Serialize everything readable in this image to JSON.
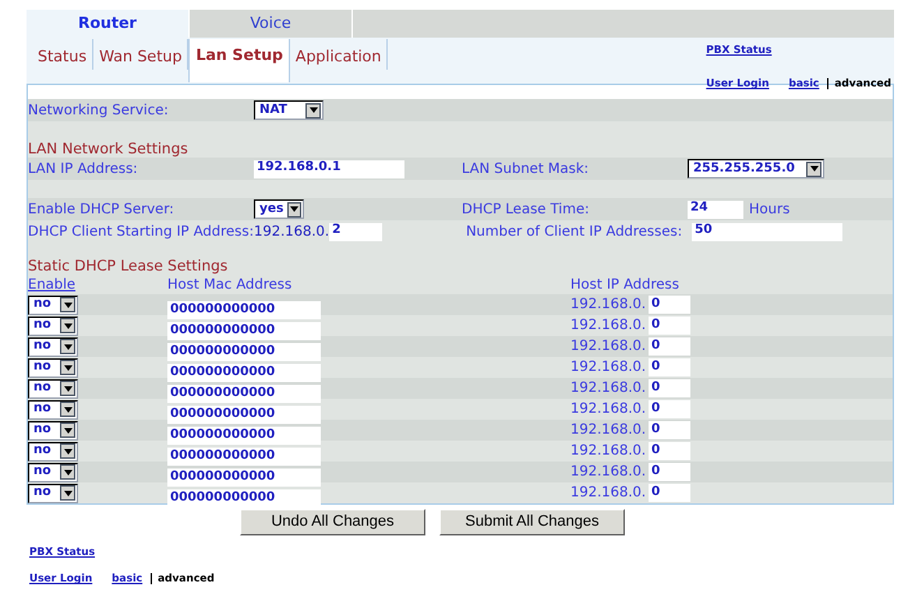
{
  "top_tabs": [
    {
      "label": "Router",
      "selected": true
    },
    {
      "label": "Voice",
      "selected": false
    }
  ],
  "sub_tabs": [
    {
      "label": "Status",
      "selected": false
    },
    {
      "label": "Wan Setup",
      "selected": false
    },
    {
      "label": "Lan Setup",
      "selected": true
    },
    {
      "label": "Application",
      "selected": false
    }
  ],
  "header_links": {
    "pbx_status": "PBX Status",
    "user_login": "User Login",
    "modes": [
      {
        "label": "basic",
        "selected": false
      },
      {
        "label": "advanced",
        "selected": true
      }
    ]
  },
  "networking_service": {
    "label": "Networking Service:",
    "value": "NAT"
  },
  "lan_network_settings": {
    "heading": "LAN Network Settings",
    "ip_label": "LAN IP Address:",
    "ip_value": "192.168.0.1",
    "mask_label": "LAN Subnet Mask:",
    "mask_value": "255.255.255.0",
    "dhcp_label": "Enable DHCP Server:",
    "dhcp_value": "yes",
    "lease_label": "DHCP Lease Time:",
    "lease_value": "24",
    "lease_unit": "Hours",
    "start_label": "DHCP Client Starting IP Address:",
    "start_prefix": "192.168.0.",
    "start_value": "2",
    "count_label": "Number of Client IP Addresses:",
    "count_value": "50"
  },
  "static_dhcp": {
    "heading": "Static DHCP Lease Settings",
    "columns": [
      "Enable",
      "Host Mac Address",
      "Host IP Address"
    ],
    "rows": [
      {
        "enable": "no",
        "mac": "000000000000",
        "ip_prefix": "192.168.0.",
        "ip_value": "0"
      },
      {
        "enable": "no",
        "mac": "000000000000",
        "ip_prefix": "192.168.0.",
        "ip_value": "0"
      },
      {
        "enable": "no",
        "mac": "000000000000",
        "ip_prefix": "192.168.0.",
        "ip_value": "0"
      },
      {
        "enable": "no",
        "mac": "000000000000",
        "ip_prefix": "192.168.0.",
        "ip_value": "0"
      },
      {
        "enable": "no",
        "mac": "000000000000",
        "ip_prefix": "192.168.0.",
        "ip_value": "0"
      },
      {
        "enable": "no",
        "mac": "000000000000",
        "ip_prefix": "192.168.0.",
        "ip_value": "0"
      },
      {
        "enable": "no",
        "mac": "000000000000",
        "ip_prefix": "192.168.0.",
        "ip_value": "0"
      },
      {
        "enable": "no",
        "mac": "000000000000",
        "ip_prefix": "192.168.0.",
        "ip_value": "0"
      },
      {
        "enable": "no",
        "mac": "000000000000",
        "ip_prefix": "192.168.0.",
        "ip_value": "0"
      },
      {
        "enable": "no",
        "mac": "000000000000",
        "ip_prefix": "192.168.0.",
        "ip_value": "0"
      }
    ]
  },
  "buttons": [
    "Undo All Changes",
    "Submit All Changes"
  ],
  "footer_links": {
    "pbx_status": "PBX Status",
    "user_login": "User Login",
    "modes": [
      {
        "label": "basic",
        "selected": false
      },
      {
        "label": "advanced",
        "selected": true
      }
    ]
  }
}
